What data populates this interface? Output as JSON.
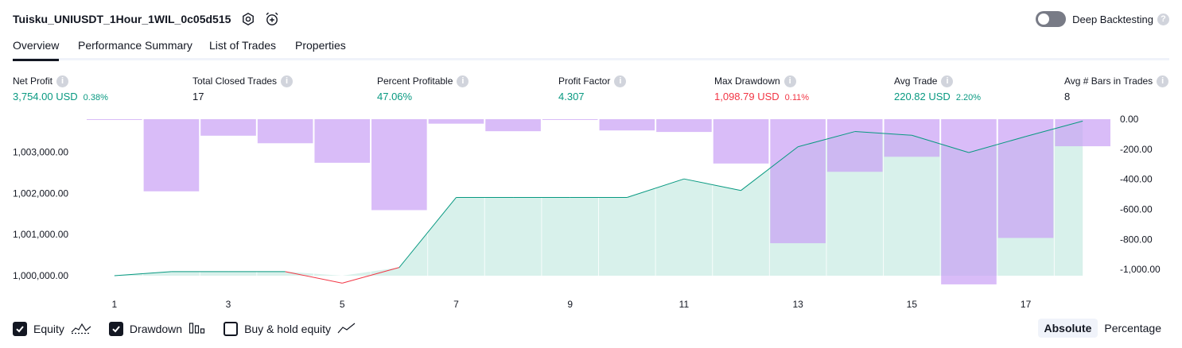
{
  "header": {
    "title": "Tuisku_UNIUSDT_1Hour_1WIL_0c05d515",
    "settings_icon": "gear-icon",
    "alert_icon": "alarm-clock-plus-icon",
    "deep_backtesting_label": "Deep Backtesting",
    "deep_backtesting_enabled": false,
    "help_icon": "question-circle-icon"
  },
  "tabs": [
    {
      "label": "Overview",
      "active": true
    },
    {
      "label": "Performance Summary",
      "active": false
    },
    {
      "label": "List of Trades",
      "active": false
    },
    {
      "label": "Properties",
      "active": false
    }
  ],
  "metrics": [
    {
      "label": "Net Profit",
      "value": "3,754.00 USD",
      "pct": "0.38%",
      "color": "#089981"
    },
    {
      "label": "Total Closed Trades",
      "value": "17",
      "pct": "",
      "color": "#131722"
    },
    {
      "label": "Percent Profitable",
      "value": "47.06%",
      "pct": "",
      "color": "#089981"
    },
    {
      "label": "Profit Factor",
      "value": "4.307",
      "pct": "",
      "color": "#089981"
    },
    {
      "label": "Max Drawdown",
      "value": "1,098.79 USD",
      "pct": "0.11%",
      "color": "#f23645"
    },
    {
      "label": "Avg Trade",
      "value": "220.82 USD",
      "pct": "2.20%",
      "color": "#089981"
    },
    {
      "label": "Avg # Bars in Trades",
      "value": "8",
      "pct": "",
      "color": "#131722"
    }
  ],
  "chart_data": {
    "type": "line",
    "x_tick_labels": [
      "1",
      "3",
      "5",
      "7",
      "9",
      "11",
      "13",
      "15",
      "17"
    ],
    "left_axis": {
      "tick_labels": [
        "1,003,000.00",
        "1,002,000.00",
        "1,001,000.00",
        "1,000,000.00"
      ],
      "ylim": [
        999750,
        1003800
      ]
    },
    "right_axis": {
      "tick_labels": [
        "0.00",
        "-200.00",
        "-400.00",
        "-600.00",
        "-800.00",
        "-1,000.00"
      ],
      "ylim": [
        -1110,
        0
      ]
    },
    "series": [
      {
        "kind": "line",
        "axis": "left",
        "x": [
          1,
          2,
          3,
          4,
          5,
          6,
          7,
          8,
          9,
          10,
          11,
          12,
          13,
          14,
          15,
          16,
          17,
          18
        ],
        "values": [
          1000000,
          1000100,
          1000100,
          1000100,
          999820,
          1000200,
          1001900,
          1001900,
          1001900,
          1001900,
          1002350,
          1002070,
          1003130,
          1003500,
          1003410,
          1002990,
          1003380,
          1003754
        ]
      },
      {
        "kind": "bar",
        "axis": "right",
        "x": [
          1,
          2,
          3,
          4,
          5,
          6,
          7,
          8,
          9,
          10,
          11,
          12,
          13,
          14,
          15,
          16,
          17,
          18
        ],
        "values": [
          -5,
          -480,
          -110,
          -160,
          -290,
          -605,
          -30,
          -80,
          -5,
          -75,
          -85,
          -295,
          -825,
          -350,
          -250,
          -1099,
          -790,
          -180
        ]
      }
    ],
    "colors": {
      "equity_up": "#089981",
      "equity_down": "#f23645",
      "equity_fill": "#d6f0ea",
      "drawdown_fill": "#c9a0f5"
    },
    "grid": "vertical-only"
  },
  "legend": {
    "items": [
      {
        "label": "Equity",
        "checked": true,
        "icon": "equity-line-icon"
      },
      {
        "label": "Drawdown",
        "checked": true,
        "icon": "drawdown-bars-icon"
      },
      {
        "label": "Buy & hold equity",
        "checked": false,
        "icon": "buy-hold-line-icon"
      }
    ],
    "modes": [
      {
        "label": "Absolute",
        "active": true
      },
      {
        "label": "Percentage",
        "active": false
      }
    ]
  }
}
